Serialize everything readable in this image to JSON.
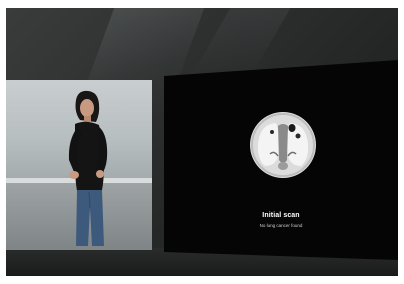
{
  "slide": {
    "title": "Initial scan",
    "subtitle": "No lung cancer found"
  },
  "scene": {
    "left_screen": "presenter-video",
    "right_screen": "slide",
    "icons": [
      "lung-ct-scan-icon"
    ]
  },
  "colors": {
    "backdrop": "#2c2e2e",
    "slide_background": "#050505",
    "slide_text": "#ffffff",
    "presenter_shirt": "#151515",
    "presenter_jeans": "#3d5a7c"
  }
}
